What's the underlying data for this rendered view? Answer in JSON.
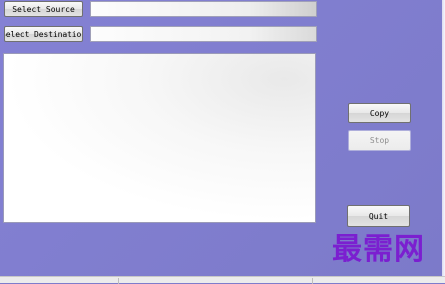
{
  "toolbar": {
    "select_source_label": "Select Source",
    "select_destination_label": "Select Destination"
  },
  "fields": {
    "source_value": "",
    "destination_value": ""
  },
  "log": {
    "content": ""
  },
  "actions": {
    "copy_label": "Copy",
    "stop_label": "Stop",
    "quit_label": "Quit"
  },
  "watermark": {
    "text": "最需网"
  },
  "colors": {
    "background": "#7e7ccc",
    "watermark": "#7b1fd0",
    "disabled_text": "#8d8d8d"
  }
}
